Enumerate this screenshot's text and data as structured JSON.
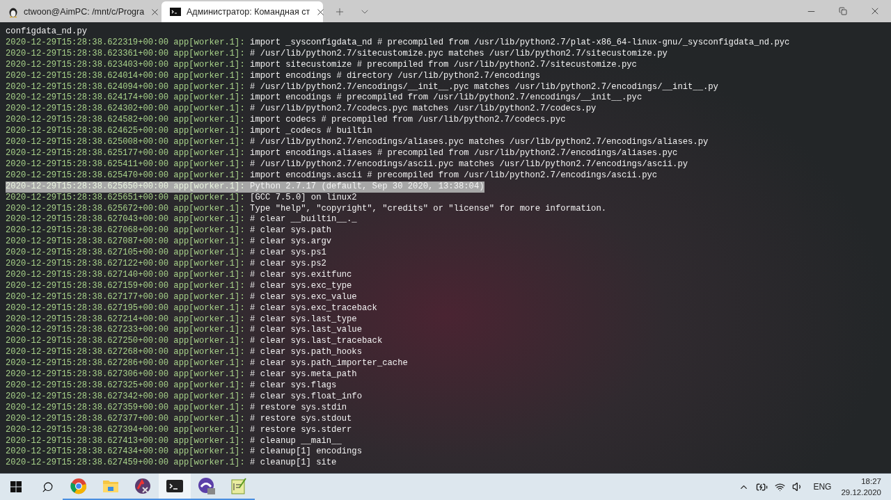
{
  "tabs": [
    {
      "kind": "linux",
      "label": "ctwoon@AimPC: /mnt/c/Progra",
      "selected": false
    },
    {
      "kind": "cmd",
      "label": "Администратор: Командная ст",
      "selected": true
    }
  ],
  "terminal": {
    "first_line": "configdata_nd.py",
    "lines": [
      {
        "ts": "2020-12-29T15:28:38.622319+00:00 app[worker.1]:",
        "msg": "import _sysconfigdata_nd # precompiled from /usr/lib/python2.7/plat-x86_64-linux-gnu/_sysconfigdata_nd.pyc",
        "selected": false
      },
      {
        "ts": "2020-12-29T15:28:38.623361+00:00 app[worker.1]:",
        "msg": "# /usr/lib/python2.7/sitecustomize.pyc matches /usr/lib/python2.7/sitecustomize.py",
        "selected": false
      },
      {
        "ts": "2020-12-29T15:28:38.623403+00:00 app[worker.1]:",
        "msg": "import sitecustomize # precompiled from /usr/lib/python2.7/sitecustomize.pyc",
        "selected": false
      },
      {
        "ts": "2020-12-29T15:28:38.624014+00:00 app[worker.1]:",
        "msg": "import encodings # directory /usr/lib/python2.7/encodings",
        "selected": false
      },
      {
        "ts": "2020-12-29T15:28:38.624094+00:00 app[worker.1]:",
        "msg": "# /usr/lib/python2.7/encodings/__init__.pyc matches /usr/lib/python2.7/encodings/__init__.py",
        "selected": false
      },
      {
        "ts": "2020-12-29T15:28:38.624174+00:00 app[worker.1]:",
        "msg": "import encodings # precompiled from /usr/lib/python2.7/encodings/__init__.pyc",
        "selected": false
      },
      {
        "ts": "2020-12-29T15:28:38.624302+00:00 app[worker.1]:",
        "msg": "# /usr/lib/python2.7/codecs.pyc matches /usr/lib/python2.7/codecs.py",
        "selected": false
      },
      {
        "ts": "2020-12-29T15:28:38.624582+00:00 app[worker.1]:",
        "msg": "import codecs # precompiled from /usr/lib/python2.7/codecs.pyc",
        "selected": false
      },
      {
        "ts": "2020-12-29T15:28:38.624625+00:00 app[worker.1]:",
        "msg": "import _codecs # builtin",
        "selected": false
      },
      {
        "ts": "2020-12-29T15:28:38.625008+00:00 app[worker.1]:",
        "msg": "# /usr/lib/python2.7/encodings/aliases.pyc matches /usr/lib/python2.7/encodings/aliases.py",
        "selected": false
      },
      {
        "ts": "2020-12-29T15:28:38.625177+00:00 app[worker.1]:",
        "msg": "import encodings.aliases # precompiled from /usr/lib/python2.7/encodings/aliases.pyc",
        "selected": false
      },
      {
        "ts": "2020-12-29T15:28:38.625411+00:00 app[worker.1]:",
        "msg": "# /usr/lib/python2.7/encodings/ascii.pyc matches /usr/lib/python2.7/encodings/ascii.py",
        "selected": false
      },
      {
        "ts": "2020-12-29T15:28:38.625470+00:00 app[worker.1]:",
        "msg": "import encodings.ascii # precompiled from /usr/lib/python2.7/encodings/ascii.pyc",
        "selected": false
      },
      {
        "ts": "2020-12-29T15:28:38.625650+00:00 app[worker.1]:",
        "msg": "Python 2.7.17 (default, Sep 30 2020, 13:38:04)",
        "selected": true
      },
      {
        "ts": "2020-12-29T15:28:38.625651+00:00 app[worker.1]:",
        "msg": "[GCC 7.5.0] on linux2",
        "selected": false
      },
      {
        "ts": "2020-12-29T15:28:38.625672+00:00 app[worker.1]:",
        "msg": "Type \"help\", \"copyright\", \"credits\" or \"license\" for more information.",
        "selected": false
      },
      {
        "ts": "2020-12-29T15:28:38.627043+00:00 app[worker.1]:",
        "msg": "# clear __builtin__._",
        "selected": false
      },
      {
        "ts": "2020-12-29T15:28:38.627068+00:00 app[worker.1]:",
        "msg": "# clear sys.path",
        "selected": false
      },
      {
        "ts": "2020-12-29T15:28:38.627087+00:00 app[worker.1]:",
        "msg": "# clear sys.argv",
        "selected": false
      },
      {
        "ts": "2020-12-29T15:28:38.627105+00:00 app[worker.1]:",
        "msg": "# clear sys.ps1",
        "selected": false
      },
      {
        "ts": "2020-12-29T15:28:38.627122+00:00 app[worker.1]:",
        "msg": "# clear sys.ps2",
        "selected": false
      },
      {
        "ts": "2020-12-29T15:28:38.627140+00:00 app[worker.1]:",
        "msg": "# clear sys.exitfunc",
        "selected": false
      },
      {
        "ts": "2020-12-29T15:28:38.627159+00:00 app[worker.1]:",
        "msg": "# clear sys.exc_type",
        "selected": false
      },
      {
        "ts": "2020-12-29T15:28:38.627177+00:00 app[worker.1]:",
        "msg": "# clear sys.exc_value",
        "selected": false
      },
      {
        "ts": "2020-12-29T15:28:38.627195+00:00 app[worker.1]:",
        "msg": "# clear sys.exc_traceback",
        "selected": false
      },
      {
        "ts": "2020-12-29T15:28:38.627214+00:00 app[worker.1]:",
        "msg": "# clear sys.last_type",
        "selected": false
      },
      {
        "ts": "2020-12-29T15:28:38.627233+00:00 app[worker.1]:",
        "msg": "# clear sys.last_value",
        "selected": false
      },
      {
        "ts": "2020-12-29T15:28:38.627250+00:00 app[worker.1]:",
        "msg": "# clear sys.last_traceback",
        "selected": false
      },
      {
        "ts": "2020-12-29T15:28:38.627268+00:00 app[worker.1]:",
        "msg": "# clear sys.path_hooks",
        "selected": false
      },
      {
        "ts": "2020-12-29T15:28:38.627286+00:00 app[worker.1]:",
        "msg": "# clear sys.path_importer_cache",
        "selected": false
      },
      {
        "ts": "2020-12-29T15:28:38.627306+00:00 app[worker.1]:",
        "msg": "# clear sys.meta_path",
        "selected": false
      },
      {
        "ts": "2020-12-29T15:28:38.627325+00:00 app[worker.1]:",
        "msg": "# clear sys.flags",
        "selected": false
      },
      {
        "ts": "2020-12-29T15:28:38.627342+00:00 app[worker.1]:",
        "msg": "# clear sys.float_info",
        "selected": false
      },
      {
        "ts": "2020-12-29T15:28:38.627359+00:00 app[worker.1]:",
        "msg": "# restore sys.stdin",
        "selected": false
      },
      {
        "ts": "2020-12-29T15:28:38.627377+00:00 app[worker.1]:",
        "msg": "# restore sys.stdout",
        "selected": false
      },
      {
        "ts": "2020-12-29T15:28:38.627394+00:00 app[worker.1]:",
        "msg": "# restore sys.stderr",
        "selected": false
      },
      {
        "ts": "2020-12-29T15:28:38.627413+00:00 app[worker.1]:",
        "msg": "# cleanup __main__",
        "selected": false
      },
      {
        "ts": "2020-12-29T15:28:38.627434+00:00 app[worker.1]:",
        "msg": "# cleanup[1] encodings",
        "selected": false
      },
      {
        "ts": "2020-12-29T15:28:38.627459+00:00 app[worker.1]:",
        "msg": "# cleanup[1] site",
        "selected": false
      }
    ]
  },
  "taskbar": {
    "apps": [
      {
        "kind": "chrome",
        "selected": false
      },
      {
        "kind": "folder",
        "selected": false
      },
      {
        "kind": "math",
        "selected": false
      },
      {
        "kind": "terminal",
        "selected": true
      },
      {
        "kind": "purple",
        "selected": false
      },
      {
        "kind": "notepad",
        "selected": false
      }
    ],
    "language": "ENG",
    "time": "18:27",
    "date": "29.12.2020"
  }
}
